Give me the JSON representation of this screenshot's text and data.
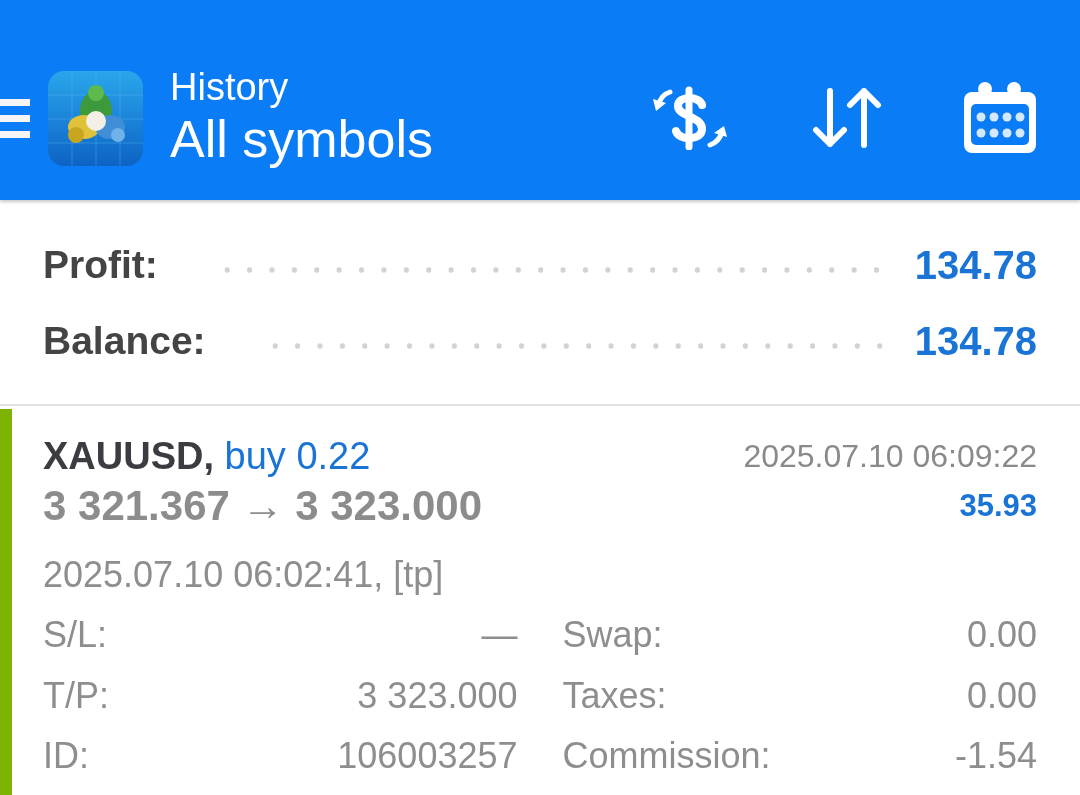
{
  "header": {
    "title": "History",
    "subtitle": "All symbols"
  },
  "summary": [
    {
      "label": "Profit:",
      "value": "134.78"
    },
    {
      "label": "Balance:",
      "value": "134.78"
    }
  ],
  "deals": [
    {
      "color": "#7cb305",
      "symbol": "XAUUSD,",
      "action": "buy 0.22",
      "close_time": "2025.07.10 06:09:22",
      "prices": "3 321.367 → 3 323.000",
      "profit": "35.93",
      "open_info": "2025.07.10 06:02:41, [tp]",
      "details": [
        {
          "label": "S/L:",
          "value": "—"
        },
        {
          "label": "Swap:",
          "value": "0.00"
        },
        {
          "label": "T/P:",
          "value": "3 323.000"
        },
        {
          "label": "Taxes:",
          "value": "0.00"
        },
        {
          "label": "ID:",
          "value": "106003257"
        },
        {
          "label": "Commission:",
          "value": "-1.54"
        }
      ]
    }
  ]
}
